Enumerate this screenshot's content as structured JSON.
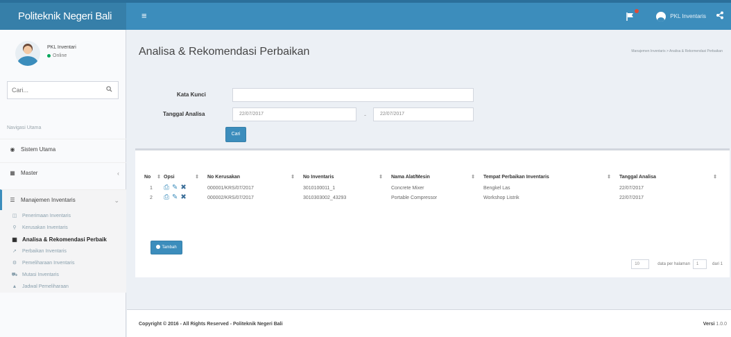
{
  "header": {
    "brand": "Politeknik Negeri Bali",
    "menu_icon": "bars-icon",
    "user_name": "PKL Inventaris"
  },
  "sidebar": {
    "user_name": "PKL Inventari",
    "status": "Online",
    "search_placeholder": "Cari...",
    "menu_header": "Navigasi Utama",
    "items": [
      {
        "label": "Sistem Utama",
        "icon": "dashboard-icon"
      },
      {
        "label": "Master",
        "icon": "table-icon"
      },
      {
        "label": "Manajemen Inventaris",
        "icon": "list-icon"
      }
    ],
    "submenu": [
      {
        "label": "Penerimaan Inventaris",
        "icon": "inbox-icon"
      },
      {
        "label": "Kerusakan Inventaris",
        "icon": "search-icon"
      },
      {
        "label": "Analisa & Rekomendasi Perbaik",
        "icon": "book-icon"
      },
      {
        "label": "Perbaikan Inventaris",
        "icon": "wrench-icon"
      },
      {
        "label": "Pemeliharaan Inventaris",
        "icon": "cogs-icon"
      },
      {
        "label": "Mutasi Inventaris",
        "icon": "truck-icon"
      },
      {
        "label": "Jadwal Pemeliharaan",
        "icon": "user-icon"
      }
    ]
  },
  "page": {
    "title": "Analisa & Rekomendasi Perbaikan",
    "breadcrumb": "Manajemen Inventaris > Analisa & Rekomendasi Perbaikan"
  },
  "filter": {
    "keyword_label": "Kata Kunci",
    "keyword_value": "",
    "date_label": "Tanggal Analisa",
    "date_from": "22/07/2017",
    "date_to": "22/07/2017",
    "separator": "-",
    "search_button": "Cari"
  },
  "table": {
    "columns": [
      "No",
      "Opsi",
      "No Kerusakan",
      "No Inventaris",
      "Nama Alat/Mesin",
      "Tempat Perbaikan Inventaris",
      "Tanggal Analisa"
    ],
    "rows": [
      {
        "no": "1",
        "no_kerusakan": "000001/KRS/07/2017",
        "no_inventaris": "3010100011_1",
        "nama": "Concrete Mixer",
        "tempat": "Bengkel Las",
        "tanggal": "22/07/2017"
      },
      {
        "no": "2",
        "no_kerusakan": "000002/KRS/07/2017",
        "no_inventaris": "3010303002_43293",
        "nama": "Portable Compressor",
        "tempat": "Workshop Listrik",
        "tanggal": "22/07/2017"
      }
    ],
    "add_button": "Tambah"
  },
  "pagination": {
    "per_page": "10",
    "label_per_page": "data per halaman",
    "page": "1",
    "label_of": "dari 1"
  },
  "footer": {
    "copyright": "Copyright © 2016 - All Rights Reserved - Politeknik Negeri Bali",
    "version_label": "Versi",
    "version": "1.0.0"
  },
  "colors": {
    "primary": "#3c8dbc",
    "header_dark": "#367fa9",
    "online": "#00a65a"
  }
}
